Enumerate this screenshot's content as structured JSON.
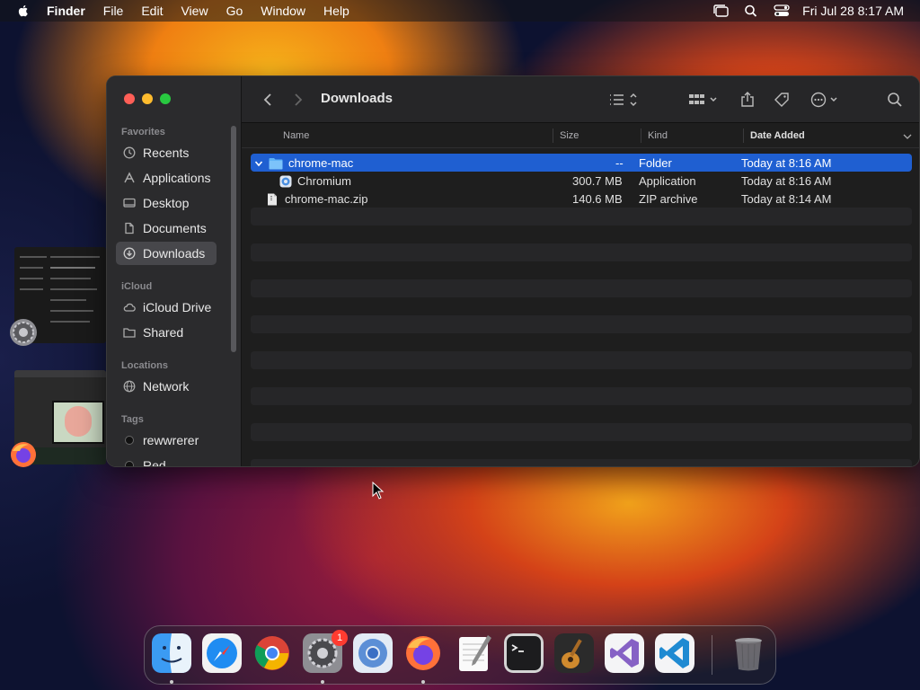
{
  "menubar": {
    "items": [
      "Finder",
      "File",
      "Edit",
      "View",
      "Go",
      "Window",
      "Help"
    ],
    "clock": "Fri Jul 28  8:17 AM"
  },
  "finder": {
    "title": "Downloads",
    "sidebar": {
      "favorites_label": "Favorites",
      "favorites": [
        "Recents",
        "Applications",
        "Desktop",
        "Documents",
        "Downloads"
      ],
      "icloud_label": "iCloud",
      "icloud": [
        "iCloud Drive",
        "Shared"
      ],
      "locations_label": "Locations",
      "locations": [
        "Network"
      ],
      "tags_label": "Tags",
      "tags": [
        "rewwrerer",
        "Red"
      ]
    },
    "columns": {
      "name": "Name",
      "size": "Size",
      "kind": "Kind",
      "date": "Date Added"
    },
    "files": [
      {
        "name": "chrome-mac",
        "size": "--",
        "kind": "Folder",
        "date": "Today at 8:16 AM"
      },
      {
        "name": "Chromium",
        "size": "300.7 MB",
        "kind": "Application",
        "date": "Today at 8:16 AM"
      },
      {
        "name": "chrome-mac.zip",
        "size": "140.6 MB",
        "kind": "ZIP archive",
        "date": "Today at 8:14 AM"
      }
    ]
  },
  "dock": {
    "apps": [
      "finder-icon",
      "safari-icon",
      "chrome-icon",
      "system-settings-icon",
      "chromium-icon",
      "firefox-icon",
      "textedit-icon",
      "terminal-icon",
      "garageband-icon",
      "visual-studio-icon",
      "vscode-icon"
    ],
    "settings_badge": "1",
    "trash": "trash-icon"
  },
  "colors": {
    "selection": "#1f5fd1",
    "sidebar_selected": "#47474b"
  }
}
